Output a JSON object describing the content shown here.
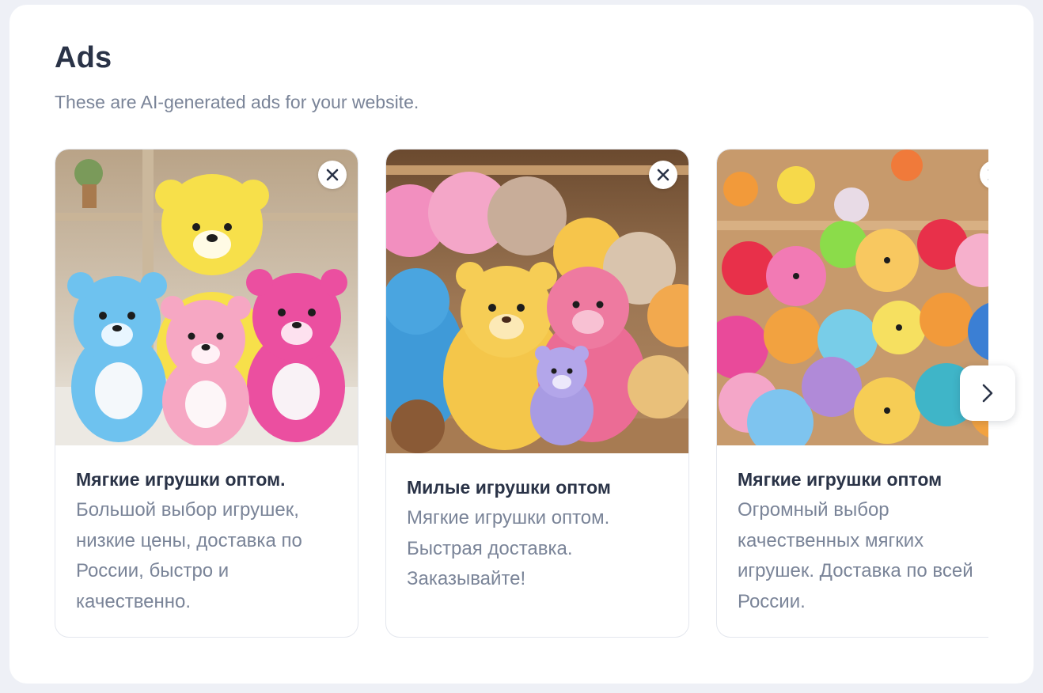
{
  "header": {
    "title": "Ads",
    "subtitle": "These are AI-generated ads for your website."
  },
  "ads": [
    {
      "title": "Мягкие игрушки оптом.",
      "body": "Большой выбор игрушек, низкие цены, доставка по России, быстро и качественно.",
      "image_icon": "teddy-bears-image",
      "close_icon": "close-icon"
    },
    {
      "title": "Милые игрушки оптом",
      "body": "Мягкие игрушки оптом. Быстрая доставка. Заказывайте!",
      "image_icon": "teddy-bears-image",
      "close_icon": "close-icon"
    },
    {
      "title": "Мягкие игрушки оптом",
      "body": "Огромный выбор качественных мягких игрушек. Доставка по всей России.",
      "image_icon": "teddy-bears-image",
      "close_icon": "close-icon"
    }
  ],
  "carousel": {
    "next_icon": "chevron-right-icon"
  },
  "colors": {
    "title": "#2a3347",
    "muted": "#7a8498",
    "card_border": "#e4e7ee",
    "page_bg": "#eef0f6"
  }
}
